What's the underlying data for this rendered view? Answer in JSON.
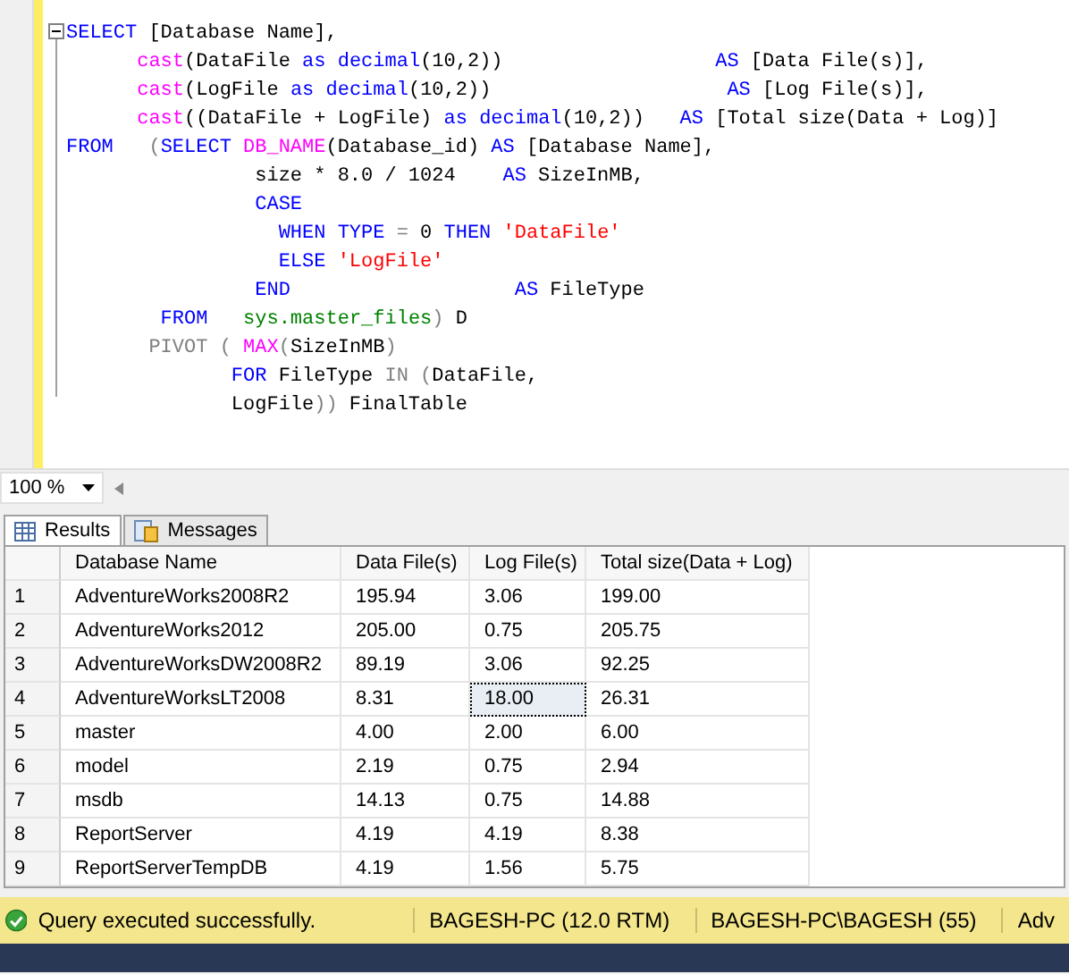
{
  "editor": {
    "lines": [
      [
        {
          "kind": "keyword",
          "text": "SELECT"
        },
        {
          "kind": "plain",
          "text": " [Database Name],"
        }
      ],
      [
        {
          "kind": "function",
          "text": "      cast"
        },
        {
          "kind": "plain",
          "text": "(DataFile "
        },
        {
          "kind": "keyword",
          "text": "as "
        },
        {
          "kind": "keyword",
          "text": "decimal"
        },
        {
          "kind": "plain",
          "text": "(10,2))                  "
        },
        {
          "kind": "keyword",
          "text": "AS"
        },
        {
          "kind": "plain",
          "text": " [Data File(s)],"
        }
      ],
      [
        {
          "kind": "function",
          "text": "      cast"
        },
        {
          "kind": "plain",
          "text": "(LogFile "
        },
        {
          "kind": "keyword",
          "text": "as "
        },
        {
          "kind": "keyword",
          "text": "decimal"
        },
        {
          "kind": "plain",
          "text": "(10,2))                    "
        },
        {
          "kind": "keyword",
          "text": "AS"
        },
        {
          "kind": "plain",
          "text": " [Log File(s)],"
        }
      ],
      [
        {
          "kind": "function",
          "text": "      cast"
        },
        {
          "kind": "plain",
          "text": "((DataFile + LogFile) "
        },
        {
          "kind": "keyword",
          "text": "as "
        },
        {
          "kind": "keyword",
          "text": "decimal"
        },
        {
          "kind": "plain",
          "text": "(10,2))   "
        },
        {
          "kind": "keyword",
          "text": "AS"
        },
        {
          "kind": "plain",
          "text": " [Total size(Data + Log)]"
        }
      ],
      [
        {
          "kind": "keyword",
          "text": "FROM"
        },
        {
          "kind": "operator",
          "text": "   ("
        },
        {
          "kind": "keyword",
          "text": "SELECT "
        },
        {
          "kind": "function",
          "text": "DB_NAME"
        },
        {
          "kind": "plain",
          "text": "(Database_id) "
        },
        {
          "kind": "keyword",
          "text": "AS"
        },
        {
          "kind": "plain",
          "text": " [Database Name],"
        }
      ],
      [
        {
          "kind": "plain",
          "text": "                size * 8.0 / 1024    "
        },
        {
          "kind": "keyword",
          "text": "AS"
        },
        {
          "kind": "plain",
          "text": " SizeInMB,"
        }
      ],
      [
        {
          "kind": "keyword",
          "text": "                CASE"
        }
      ],
      [
        {
          "kind": "keyword",
          "text": "                  WHEN TYPE"
        },
        {
          "kind": "operator",
          "text": " = "
        },
        {
          "kind": "plain",
          "text": "0 "
        },
        {
          "kind": "keyword",
          "text": "THEN "
        },
        {
          "kind": "string",
          "text": "'DataFile'"
        }
      ],
      [
        {
          "kind": "keyword",
          "text": "                  ELSE "
        },
        {
          "kind": "string",
          "text": "'LogFile'"
        }
      ],
      [
        {
          "kind": "keyword",
          "text": "                END                   AS"
        },
        {
          "kind": "plain",
          "text": " FileType"
        }
      ],
      [
        {
          "kind": "keyword",
          "text": "        FROM   "
        },
        {
          "kind": "system",
          "text": "sys.master_files"
        },
        {
          "kind": "operator",
          "text": ")"
        },
        {
          "kind": "plain",
          "text": " D"
        }
      ],
      [
        {
          "kind": "operator",
          "text": "       PIVOT ( "
        },
        {
          "kind": "function",
          "text": "MAX"
        },
        {
          "kind": "operator",
          "text": "("
        },
        {
          "kind": "plain",
          "text": "SizeInMB"
        },
        {
          "kind": "operator",
          "text": ")"
        }
      ],
      [
        {
          "kind": "keyword",
          "text": "              FOR"
        },
        {
          "kind": "plain",
          "text": " FileType "
        },
        {
          "kind": "operator",
          "text": "IN ("
        },
        {
          "kind": "plain",
          "text": "DataFile,"
        }
      ],
      [
        {
          "kind": "plain",
          "text": "              LogFile"
        },
        {
          "kind": "operator",
          "text": "))"
        },
        {
          "kind": "plain",
          "text": " FinalTable"
        }
      ]
    ]
  },
  "zoom": {
    "value": "100 %"
  },
  "tabs": [
    {
      "label": "Results",
      "selected": true
    },
    {
      "label": "Messages",
      "selected": false
    }
  ],
  "grid": {
    "columns": [
      "Database Name",
      "Data File(s)",
      "Log File(s)",
      "Total size(Data + Log)"
    ],
    "rows": [
      {
        "number": "1",
        "cells": [
          {
            "text": "AdventureWorks2008R2",
            "selected": false
          },
          {
            "text": "195.94",
            "selected": false
          },
          {
            "text": "3.06",
            "selected": false
          },
          {
            "text": "199.00",
            "selected": false
          }
        ]
      },
      {
        "number": "2",
        "cells": [
          {
            "text": "AdventureWorks2012",
            "selected": false
          },
          {
            "text": "205.00",
            "selected": false
          },
          {
            "text": "0.75",
            "selected": false
          },
          {
            "text": "205.75",
            "selected": false
          }
        ]
      },
      {
        "number": "3",
        "cells": [
          {
            "text": "AdventureWorksDW2008R2",
            "selected": false
          },
          {
            "text": "89.19",
            "selected": false
          },
          {
            "text": "3.06",
            "selected": false
          },
          {
            "text": "92.25",
            "selected": false
          }
        ]
      },
      {
        "number": "4",
        "cells": [
          {
            "text": "AdventureWorksLT2008",
            "selected": false
          },
          {
            "text": "8.31",
            "selected": false
          },
          {
            "text": "18.00",
            "selected": true
          },
          {
            "text": "26.31",
            "selected": false
          }
        ]
      },
      {
        "number": "5",
        "cells": [
          {
            "text": "master",
            "selected": false
          },
          {
            "text": "4.00",
            "selected": false
          },
          {
            "text": "2.00",
            "selected": false
          },
          {
            "text": "6.00",
            "selected": false
          }
        ]
      },
      {
        "number": "6",
        "cells": [
          {
            "text": "model",
            "selected": false
          },
          {
            "text": "2.19",
            "selected": false
          },
          {
            "text": "0.75",
            "selected": false
          },
          {
            "text": "2.94",
            "selected": false
          }
        ]
      },
      {
        "number": "7",
        "cells": [
          {
            "text": "msdb",
            "selected": false
          },
          {
            "text": "14.13",
            "selected": false
          },
          {
            "text": "0.75",
            "selected": false
          },
          {
            "text": "14.88",
            "selected": false
          }
        ]
      },
      {
        "number": "8",
        "cells": [
          {
            "text": "ReportServer",
            "selected": false
          },
          {
            "text": "4.19",
            "selected": false
          },
          {
            "text": "4.19",
            "selected": false
          },
          {
            "text": "8.38",
            "selected": false
          }
        ]
      },
      {
        "number": "9",
        "cells": [
          {
            "text": "ReportServerTempDB",
            "selected": false
          },
          {
            "text": "4.19",
            "selected": false
          },
          {
            "text": "1.56",
            "selected": false
          },
          {
            "text": "5.75",
            "selected": false
          }
        ]
      }
    ]
  },
  "status_bar": {
    "message": "Query executed successfully.",
    "server": "BAGESH-PC (12.0 RTM)",
    "user": "BAGESH-PC\\BAGESH (55)",
    "database": "Adv"
  }
}
